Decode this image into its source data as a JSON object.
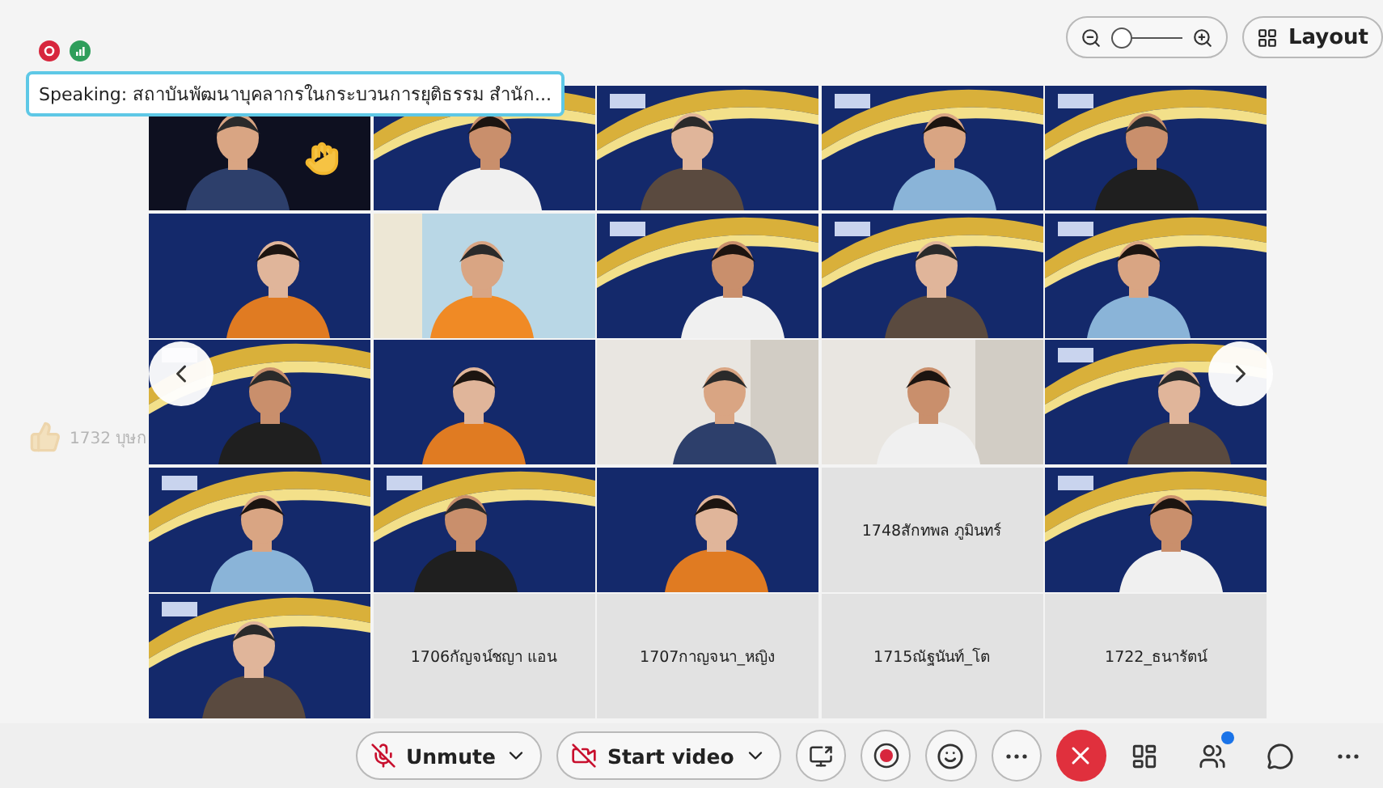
{
  "speaking": {
    "text": "Speaking: สถาบันพัฒนาบุคลากรในกระบวนการยุติธรรม สำนัก..."
  },
  "zoom": {
    "level": 0.12
  },
  "layout_button": {
    "label": "Layout"
  },
  "reaction": {
    "text": "1732 บุษก"
  },
  "tiles": [
    {
      "kind": "video",
      "hand_raised": true
    },
    {
      "kind": "video",
      "hand_raised": false
    },
    {
      "kind": "video",
      "hand_raised": false
    },
    {
      "kind": "video",
      "hand_raised": false
    },
    {
      "kind": "video",
      "hand_raised": false
    },
    {
      "kind": "video",
      "hand_raised": false
    },
    {
      "kind": "video",
      "hand_raised": false
    },
    {
      "kind": "video",
      "hand_raised": false
    },
    {
      "kind": "video",
      "hand_raised": false
    },
    {
      "kind": "video",
      "hand_raised": false
    },
    {
      "kind": "video",
      "hand_raised": false
    },
    {
      "kind": "video",
      "hand_raised": false
    },
    {
      "kind": "video",
      "hand_raised": false
    },
    {
      "kind": "video",
      "hand_raised": false
    },
    {
      "kind": "video",
      "hand_raised": false
    },
    {
      "kind": "video",
      "hand_raised": false
    },
    {
      "kind": "video",
      "hand_raised": false
    },
    {
      "kind": "video",
      "hand_raised": false
    },
    {
      "kind": "name",
      "name": "1748สักทพล ภูมินทร์",
      "hand_raised": false
    },
    {
      "kind": "video",
      "hand_raised": false
    },
    {
      "kind": "video",
      "hand_raised": false
    },
    {
      "kind": "name",
      "name": "1706กัญจน์ชญา แอน",
      "hand_raised": false
    },
    {
      "kind": "name",
      "name": "1707กาญจนา_หญิง",
      "hand_raised": false
    },
    {
      "kind": "name",
      "name": "1715ณัฐนันท์_โต",
      "hand_raised": false
    },
    {
      "kind": "name",
      "name": "1722_ธนารัตน์",
      "hand_raised": false
    }
  ],
  "toolbar": {
    "mute_label": "Unmute",
    "video_label": "Start video",
    "participants_notice": true
  }
}
